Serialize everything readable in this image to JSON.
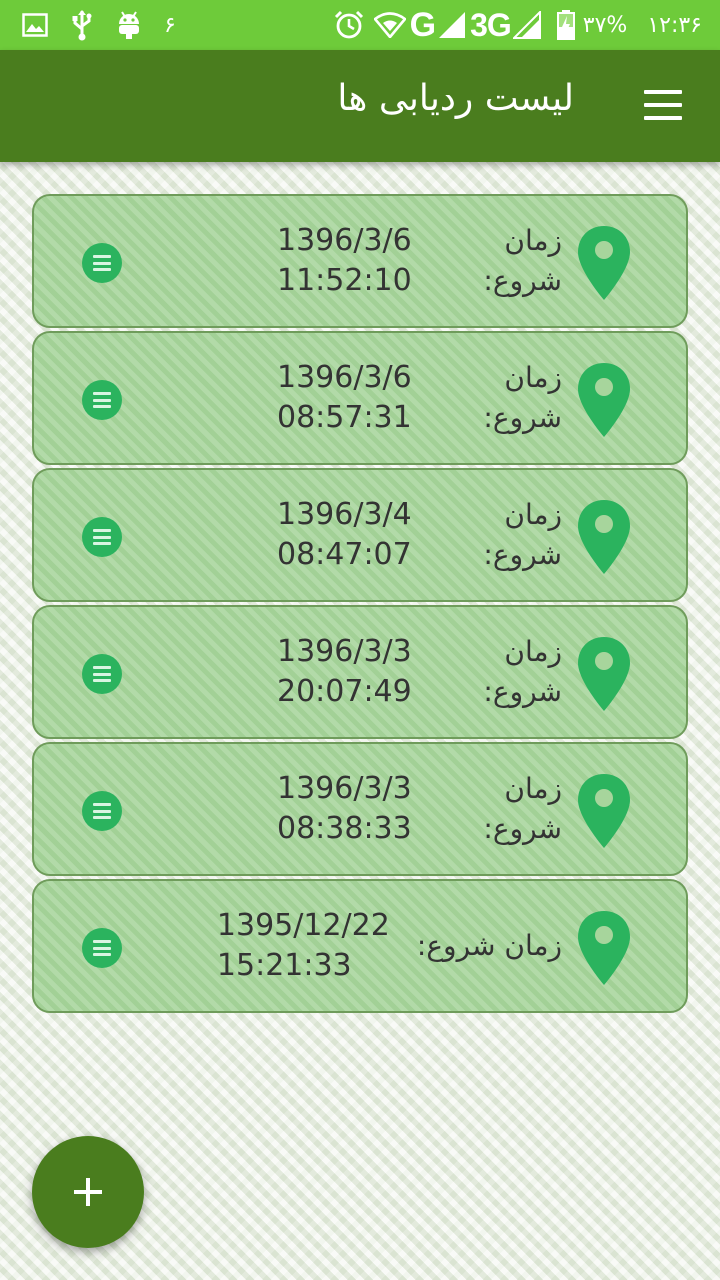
{
  "status_bar": {
    "notification_count": "۶",
    "network_g": "G",
    "network_3g": "3G",
    "battery_percent": "۳۷%",
    "clock": "۱۲:۳۶"
  },
  "app_bar": {
    "title": "لیست ردیابی ها"
  },
  "tracks": [
    {
      "label": "زمان شروع:",
      "datetime": "1396/3/6 11:52:10"
    },
    {
      "label": "زمان شروع:",
      "datetime": "1396/3/6 08:57:31"
    },
    {
      "label": "زمان شروع:",
      "datetime": "1396/3/4 08:47:07"
    },
    {
      "label": "زمان شروع:",
      "datetime": "1396/3/3 20:07:49"
    },
    {
      "label": "زمان شروع:",
      "datetime": "1396/3/3 08:38:33"
    },
    {
      "label": "زمان شروع:",
      "datetime": "1395/12/22 15:21:33"
    }
  ],
  "icons": {
    "card_icon": "location-pin-icon",
    "card_action_icon": "options-menu-icon",
    "fab_icon": "plus-icon",
    "menu_icon": "hamburger-menu-icon"
  },
  "colors": {
    "status_bar": "#6ecb3a",
    "app_bar": "#4a7d1e",
    "card_background": "#a7d59c",
    "pin": "#2bb35e"
  }
}
